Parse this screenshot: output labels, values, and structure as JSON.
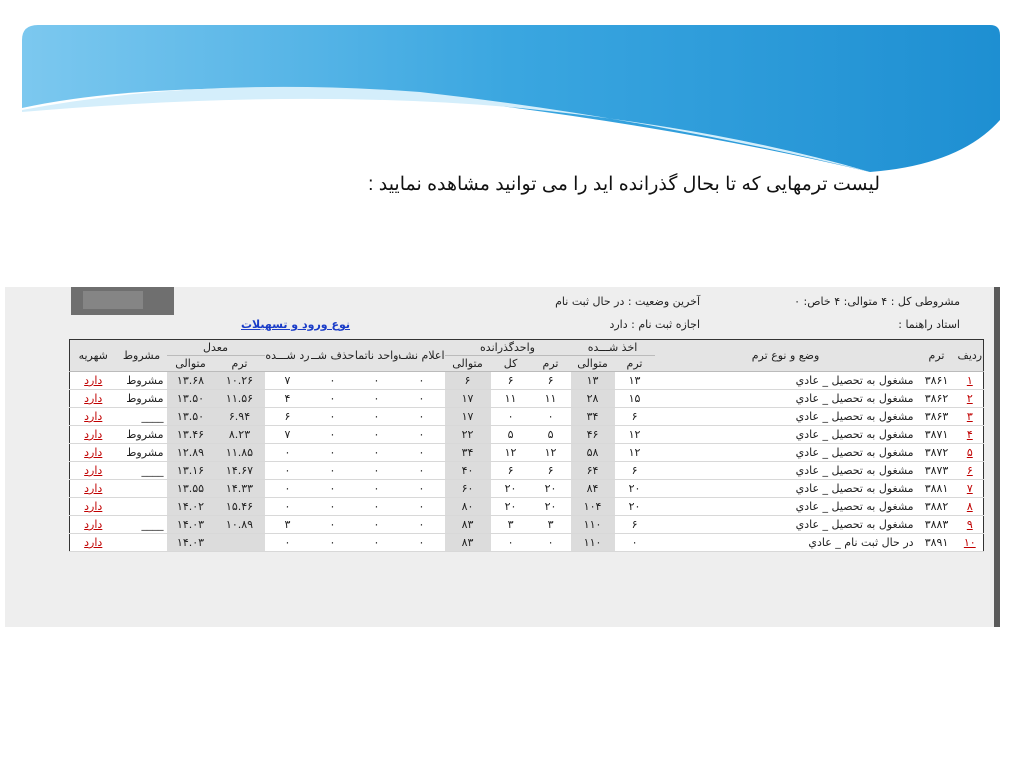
{
  "slide_title": "لیست ترمهایی که تا بحال گذرانده اید را می توانید مشاهده نمایید :",
  "info": {
    "conditional_text": "مشروطی کل : ۴   متوالی: ۴   خاص: ۰",
    "last_status": "آخرین وضعیت : در حال ثبت نام",
    "advisor": "استاد راهنما :",
    "register_permission": "اجازه ثبت نام : دارد",
    "entry_link": "نوع ورود و تسهیلات"
  },
  "table": {
    "group_headers": {
      "taken": "اخذ شـــده",
      "passed": "واحدگذرانده",
      "average": "معدل"
    },
    "columns": {
      "row": "ردیف",
      "term": "ترم",
      "status": "وضع و نوع ترم",
      "taken_term": "ترم",
      "taken_cum": "متوالی",
      "passed_term": "ترم",
      "passed_total": "کل",
      "passed_cum": "متوالی",
      "not_announced": "اعلام نشـده",
      "incomplete": "واحد ناتمام",
      "deleted": "حذف شــده",
      "rejected": "رد شـــده",
      "avg_term": "ترم",
      "avg_cum": "متوالی",
      "conditional": "مشروط",
      "tuition": "شهریه"
    },
    "rows": [
      {
        "idx": "۱",
        "term": "۳۸۶۱",
        "status": "مشغول به تحصیل _ عادي",
        "tt": "۱۳",
        "tc": "۱۳",
        "pt": "۶",
        "pk": "۶",
        "pc": "۶",
        "na": "۰",
        "inc": "۰",
        "del": "۰",
        "rej": "۷",
        "at": "۱۰.۲۶",
        "ac": "۱۳.۶۸",
        "cond": "مشروط",
        "fee": "دارد"
      },
      {
        "idx": "۲",
        "term": "۳۸۶۲",
        "status": "مشغول به تحصیل _ عادي",
        "tt": "۱۵",
        "tc": "۲۸",
        "pt": "۱۱",
        "pk": "۱۱",
        "pc": "۱۷",
        "na": "۰",
        "inc": "۰",
        "del": "۰",
        "rej": "۴",
        "at": "۱۱.۵۶",
        "ac": "۱۳.۵۰",
        "cond": "مشروط",
        "fee": "دارد"
      },
      {
        "idx": "۳",
        "term": "۳۸۶۳",
        "status": "مشغول به تحصیل _ عادي",
        "tt": "۶",
        "tc": "۳۴",
        "pt": "۰",
        "pk": "۰",
        "pc": "۱۷",
        "na": "۰",
        "inc": "۰",
        "del": "۰",
        "rej": "۶",
        "at": "۶.۹۴",
        "ac": "۱۳.۵۰",
        "cond": "____",
        "fee": "دارد"
      },
      {
        "idx": "۴",
        "term": "۳۸۷۱",
        "status": "مشغول به تحصیل _ عادي",
        "tt": "۱۲",
        "tc": "۴۶",
        "pt": "۵",
        "pk": "۵",
        "pc": "۲۲",
        "na": "۰",
        "inc": "۰",
        "del": "۰",
        "rej": "۷",
        "at": "۸.۲۳",
        "ac": "۱۳.۴۶",
        "cond": "مشروط",
        "fee": "دارد"
      },
      {
        "idx": "۵",
        "term": "۳۸۷۲",
        "status": "مشغول به تحصیل _ عادي",
        "tt": "۱۲",
        "tc": "۵۸",
        "pt": "۱۲",
        "pk": "۱۲",
        "pc": "۳۴",
        "na": "۰",
        "inc": "۰",
        "del": "۰",
        "rej": "۰",
        "at": "۱۱.۸۵",
        "ac": "۱۲.۸۹",
        "cond": "مشروط",
        "fee": "دارد"
      },
      {
        "idx": "۶",
        "term": "۳۸۷۳",
        "status": "مشغول به تحصیل _ عادي",
        "tt": "۶",
        "tc": "۶۴",
        "pt": "۶",
        "pk": "۶",
        "pc": "۴۰",
        "na": "۰",
        "inc": "۰",
        "del": "۰",
        "rej": "۰",
        "at": "۱۴.۶۷",
        "ac": "۱۳.۱۶",
        "cond": "____",
        "fee": "دارد"
      },
      {
        "idx": "۷",
        "term": "۳۸۸۱",
        "status": "مشغول به تحصیل _ عادي",
        "tt": "۲۰",
        "tc": "۸۴",
        "pt": "۲۰",
        "pk": "۲۰",
        "pc": "۶۰",
        "na": "۰",
        "inc": "۰",
        "del": "۰",
        "rej": "۰",
        "at": "۱۴.۳۳",
        "ac": "۱۳.۵۵",
        "cond": "",
        "fee": "دارد"
      },
      {
        "idx": "۸",
        "term": "۳۸۸۲",
        "status": "مشغول به تحصیل _ عادي",
        "tt": "۲۰",
        "tc": "۱۰۴",
        "pt": "۲۰",
        "pk": "۲۰",
        "pc": "۸۰",
        "na": "۰",
        "inc": "۰",
        "del": "۰",
        "rej": "۰",
        "at": "۱۵.۴۶",
        "ac": "۱۴.۰۲",
        "cond": "",
        "fee": "دارد"
      },
      {
        "idx": "۹",
        "term": "۳۸۸۳",
        "status": "مشغول به تحصیل _ عادي",
        "tt": "۶",
        "tc": "۱۱۰",
        "pt": "۳",
        "pk": "۳",
        "pc": "۸۳",
        "na": "۰",
        "inc": "۰",
        "del": "۰",
        "rej": "۳",
        "at": "۱۰.۸۹",
        "ac": "۱۴.۰۳",
        "cond": "____",
        "fee": "دارد"
      },
      {
        "idx": "۱۰",
        "term": "۳۸۹۱",
        "status": "در حال ثبت نام _ عادي",
        "tt": "۰",
        "tc": "۱۱۰",
        "pt": "۰",
        "pk": "۰",
        "pc": "۸۳",
        "na": "۰",
        "inc": "۰",
        "del": "۰",
        "rej": "۰",
        "at": "",
        "ac": "۱۴.۰۳",
        "cond": "",
        "fee": "دارد"
      }
    ]
  },
  "colors": {
    "wave_dark": "#1f8fd0",
    "wave_light": "#8fd3f4",
    "link": "#1a3cc8",
    "red_link": "#c00000"
  }
}
